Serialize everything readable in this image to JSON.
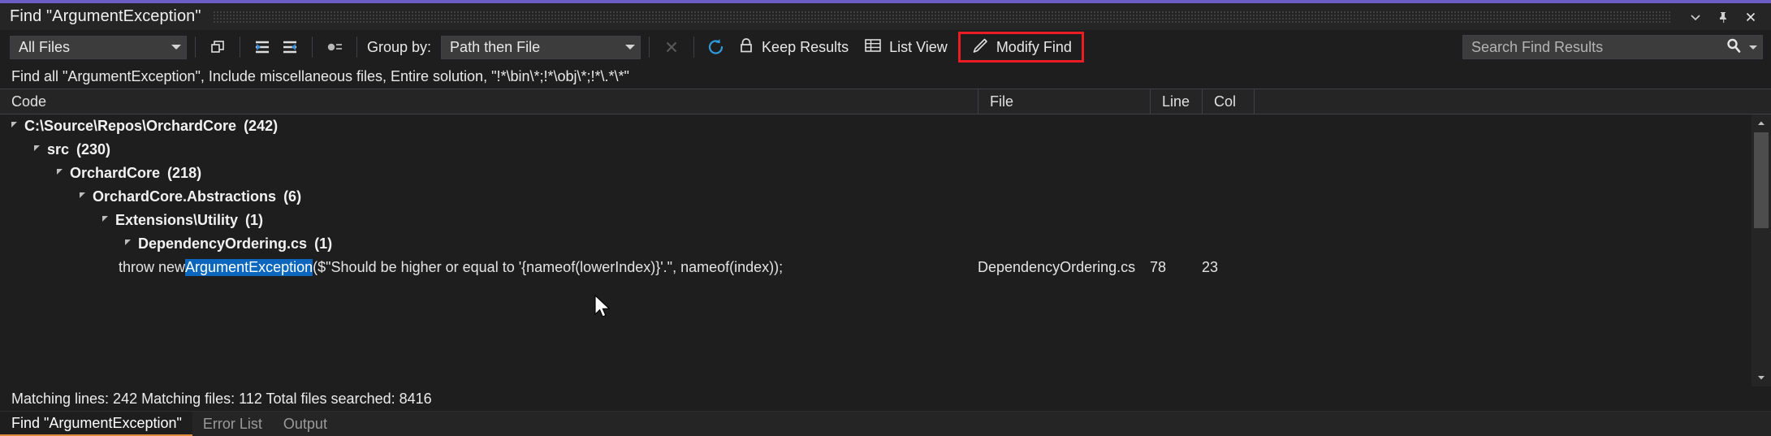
{
  "window": {
    "title": "Find \"ArgumentException\"",
    "accent_color": "#6b5fc7",
    "controls": {
      "minimize": "minimize-icon",
      "pin": "pin-icon",
      "close": "close-icon"
    }
  },
  "toolbar": {
    "filter_combo": {
      "value": "All Files",
      "name": "file-filter-dropdown"
    },
    "copy_button_label": "Copy",
    "collapse_button_label": "Collapse All",
    "expand_button_label": "Expand All",
    "properties_button_label": "Properties",
    "group_by_label": "Group by:",
    "group_by_combo": {
      "value": "Path then File",
      "name": "group-by-dropdown"
    },
    "stop_label": "Stop",
    "refresh_label": "Refresh",
    "keep_results_label": "Keep Results",
    "list_view_label": "List View",
    "modify_find_label": "Modify Find",
    "modify_find_highlight_color": "#ec1c24",
    "search": {
      "placeholder": "Search Find Results",
      "value": ""
    }
  },
  "description": "Find all \"ArgumentException\", Include miscellaneous files, Entire solution, \"!*\\bin\\*;!*\\obj\\*;!*\\.*\\*\"",
  "columns": {
    "code": "Code",
    "file": "File",
    "line": "Line",
    "col": "Col"
  },
  "rows": [
    {
      "type": "group",
      "indent": 0,
      "label": "C:\\Source\\Repos\\OrchardCore",
      "count": "(242)"
    },
    {
      "type": "group",
      "indent": 1,
      "label": "src",
      "count": "(230)"
    },
    {
      "type": "group",
      "indent": 2,
      "label": "OrchardCore",
      "count": "(218)"
    },
    {
      "type": "group",
      "indent": 3,
      "label": "OrchardCore.Abstractions",
      "count": "(6)"
    },
    {
      "type": "group",
      "indent": 4,
      "label": "Extensions\\Utility",
      "count": "(1)"
    },
    {
      "type": "group",
      "indent": 5,
      "label": "DependencyOrdering.cs",
      "count": "(1)"
    },
    {
      "type": "match",
      "indent": 6,
      "code_before": "throw new ",
      "code_match": "ArgumentException",
      "code_after": "($\"Should be higher or equal to '{nameof(lowerIndex)}'.\", nameof(index));",
      "file": "DependencyOrdering.cs",
      "line": "78",
      "col": "23",
      "highlight_color": "#0a67bd"
    }
  ],
  "status": "Matching lines: 242 Matching files: 112 Total files searched: 8416",
  "tabs": [
    {
      "label": "Find \"ArgumentException\"",
      "active": true
    },
    {
      "label": "Error List",
      "active": false
    },
    {
      "label": "Output",
      "active": false
    }
  ]
}
